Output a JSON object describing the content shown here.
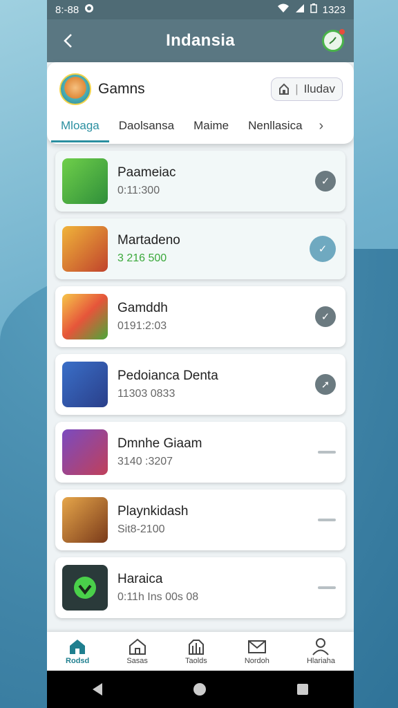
{
  "status_bar": {
    "time": "8:-88",
    "right_text": "1323"
  },
  "app_bar": {
    "title": "Indansia"
  },
  "header": {
    "title": "Gamns",
    "pill_label": "Iludav"
  },
  "tabs": [
    {
      "label": "Mloaga",
      "active": true
    },
    {
      "label": "Daolsansa",
      "active": false
    },
    {
      "label": "Maime",
      "active": false
    },
    {
      "label": "Nenllasica",
      "active": false
    }
  ],
  "games": [
    {
      "name": "Paameiac",
      "sub": "0:11:300",
      "status": "check"
    },
    {
      "name": "Martadeno",
      "sub": "3 216 500",
      "status": "check-active"
    },
    {
      "name": "Gamddh",
      "sub": "0191:2:03",
      "status": "check"
    },
    {
      "name": "Pedoianca Denta",
      "sub": "11303 0833",
      "status": "arrow"
    },
    {
      "name": "Dmnhe Giaam",
      "sub": "3140 :3207",
      "status": "dash"
    },
    {
      "name": "Playnkidash",
      "sub": "Sit8-2100",
      "status": "dash"
    },
    {
      "name": "Haraica",
      "sub": "0:11h Ins 00s 08",
      "status": "dash"
    }
  ],
  "bottom_nav": [
    {
      "label": "Rodsd",
      "icon": "home-filled-icon"
    },
    {
      "label": "Sasas",
      "icon": "home-icon"
    },
    {
      "label": "Taolds",
      "icon": "stats-icon"
    },
    {
      "label": "Nordoh",
      "icon": "mail-icon"
    },
    {
      "label": "Hlariaha",
      "icon": "person-icon"
    }
  ],
  "colors": {
    "accent": "#2a8fa0",
    "app_bar": "#5a7782",
    "success": "#3aa83a"
  }
}
